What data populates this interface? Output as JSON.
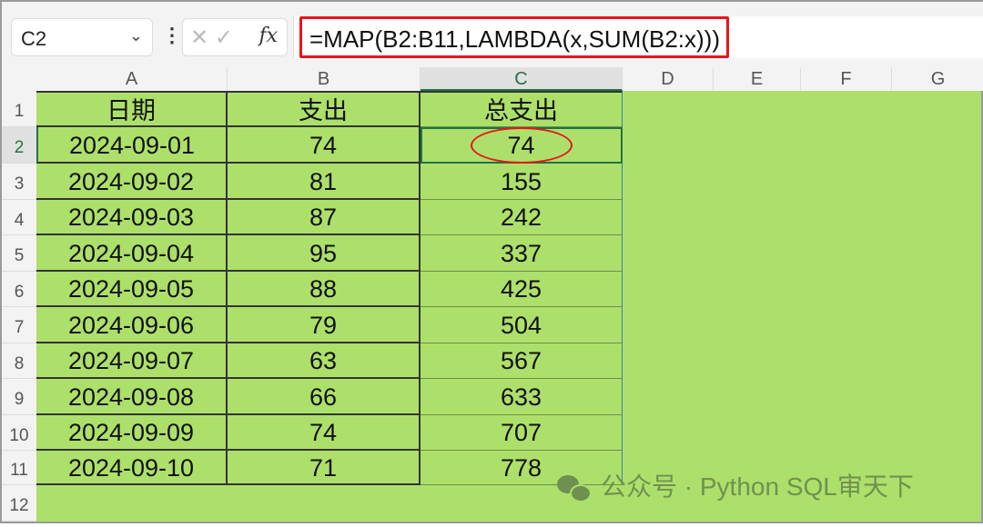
{
  "name_box": {
    "value": "C2"
  },
  "formula_bar": {
    "formula": "=MAP(B2:B11,LAMBDA(x,SUM(B2:x)))",
    "cancel": "✕",
    "enter": "✓",
    "fx": "fx"
  },
  "columns": [
    "A",
    "B",
    "C",
    "D",
    "E",
    "F",
    "G"
  ],
  "rows": [
    "1",
    "2",
    "3",
    "4",
    "5",
    "6",
    "7",
    "8",
    "9",
    "10",
    "11",
    "12"
  ],
  "headers": [
    "日期",
    "支出",
    "总支出"
  ],
  "table": [
    [
      "2024-09-01",
      "74",
      "74"
    ],
    [
      "2024-09-02",
      "81",
      "155"
    ],
    [
      "2024-09-03",
      "87",
      "242"
    ],
    [
      "2024-09-04",
      "95",
      "337"
    ],
    [
      "2024-09-05",
      "88",
      "425"
    ],
    [
      "2024-09-06",
      "79",
      "504"
    ],
    [
      "2024-09-07",
      "63",
      "567"
    ],
    [
      "2024-09-08",
      "66",
      "633"
    ],
    [
      "2024-09-09",
      "74",
      "707"
    ],
    [
      "2024-09-10",
      "71",
      "778"
    ]
  ],
  "selected_cell": "C2",
  "watermark": "公众号 · Python SQL审天下",
  "colors": {
    "sheet": "#ade06a",
    "highlight": "#e8141c"
  }
}
